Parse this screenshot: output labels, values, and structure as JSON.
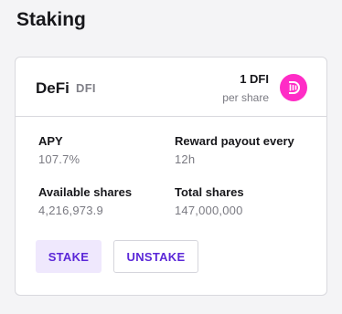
{
  "page": {
    "title": "Staking"
  },
  "token": {
    "name": "DeFi",
    "symbol": "DFI",
    "price_value": "1 DFI",
    "price_unit": "per share",
    "logo_icon": "defichain-logo-icon",
    "logo_color": "#ff2cc6"
  },
  "stats": {
    "apy": {
      "label": "APY",
      "value": "107.7%"
    },
    "reward_payout": {
      "label": "Reward payout every",
      "value": "12h"
    },
    "available_shares": {
      "label": "Available shares",
      "value": "4,216,973.9"
    },
    "total_shares": {
      "label": "Total shares",
      "value": "147,000,000"
    }
  },
  "actions": {
    "stake_label": "STAKE",
    "unstake_label": "UNSTAKE"
  },
  "colors": {
    "accent": "#5b27d8",
    "accent_bg": "#efe8fd",
    "background": "#f4f4f6"
  }
}
